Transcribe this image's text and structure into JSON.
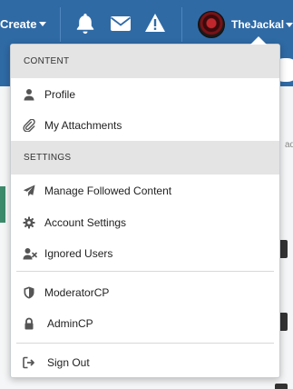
{
  "topbar": {
    "create_label": "Create",
    "username": "TheJackal",
    "icons": [
      "bell-icon",
      "envelope-icon",
      "warning-icon"
    ]
  },
  "background": {
    "side_text": "ad"
  },
  "dropdown": {
    "sections": {
      "content_header": "CONTENT",
      "settings_header": "SETTINGS"
    },
    "items": {
      "profile": "Profile",
      "attachments": "My Attachments",
      "followed": "Manage Followed Content",
      "account": "Account Settings",
      "ignored": "Ignored Users",
      "modcp": "ModeratorCP",
      "admincp": "AdminCP",
      "signout": "Sign Out"
    }
  },
  "colors": {
    "header_bg": "#2f6aa5",
    "menu_bg": "#ffffff",
    "section_bg": "#e4e4e4",
    "icon_color": "#555555"
  }
}
